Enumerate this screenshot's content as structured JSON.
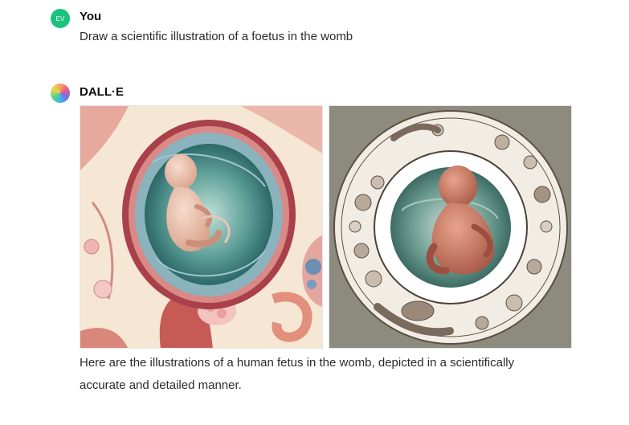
{
  "user_message": {
    "avatar_initials": "EV",
    "author": "You",
    "text": "Draw a scientific illustration of a foetus in the womb"
  },
  "assistant_message": {
    "author": "DALL·E",
    "images": [
      {
        "icon": "foetus-womb-illustration-1"
      },
      {
        "icon": "foetus-womb-illustration-2"
      }
    ],
    "caption_line1": "Here are the illustrations of a human fetus in the womb, depicted in a scientifically",
    "caption_line2": "accurate and detailed manner."
  },
  "colors": {
    "user_avatar": "#19c37d",
    "text": "#0d0d0d"
  }
}
